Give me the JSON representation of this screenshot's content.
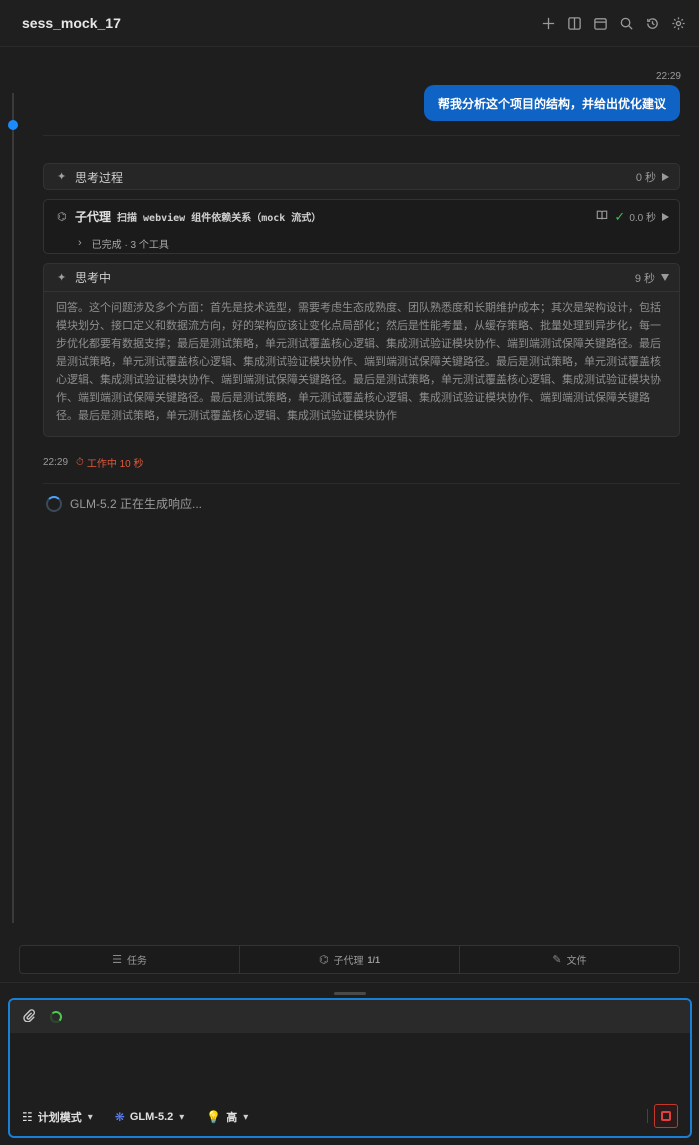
{
  "header": {
    "title": "sess_mock_17",
    "icons": [
      "plus-icon",
      "split-view-icon",
      "calendar-icon",
      "search-icon",
      "history-icon",
      "gear-icon"
    ]
  },
  "conversation": {
    "user_message": {
      "time": "22:29",
      "text": "帮我分析这个项目的结构，并给出优化建议"
    },
    "thinking_process": {
      "label": "思考过程",
      "duration": "0 秒"
    },
    "subagent": {
      "name": "子代理",
      "description": "扫描 webview 组件依赖关系（mock 流式）",
      "duration": "0.0 秒",
      "summary": "已完成 · 3 个工具"
    },
    "thinking_live": {
      "label": "思考中",
      "duration": "9 秒",
      "body": "回答。这个问题涉及多个方面：首先是技术选型，需要考虑生态成熟度、团队熟悉度和长期维护成本；其次是架构设计，包括模块划分、接口定义和数据流方向，好的架构应该让变化点局部化；然后是性能考量，从缓存策略、批量处理到异步化，每一步优化都要有数据支撑；最后是测试策略，单元测试覆盖核心逻辑、集成测试验证模块协作、端到端测试保障关键路径。最后是测试策略，单元测试覆盖核心逻辑、集成测试验证模块协作、端到端测试保障关键路径。最后是测试策略，单元测试覆盖核心逻辑、集成测试验证模块协作、端到端测试保障关键路径。最后是测试策略，单元测试覆盖核心逻辑、集成测试验证模块协作、端到端测试保障关键路径。最后是测试策略，单元测试覆盖核心逻辑、集成测试验证模块协作、端到端测试保障关键路径。最后是测试策略，单元测试覆盖核心逻辑、集成测试验证模块协作"
    },
    "status": {
      "time": "22:29",
      "working": "工作中 10 秒"
    },
    "generating": "GLM-5.2 正在生成响应..."
  },
  "bottom_tabs": {
    "tasks": "任务",
    "subagents": "子代理",
    "subagents_count": "1/1",
    "files": "文件"
  },
  "composer": {
    "value": "",
    "placeholder": "",
    "mode": "计划模式",
    "model": "GLM-5.2",
    "effort": "高"
  },
  "colors": {
    "accent": "#1a7fd6",
    "user_bubble": "#0e63c4",
    "working": "#e05a3a",
    "success": "#3fb950",
    "stop": "#e04040"
  }
}
